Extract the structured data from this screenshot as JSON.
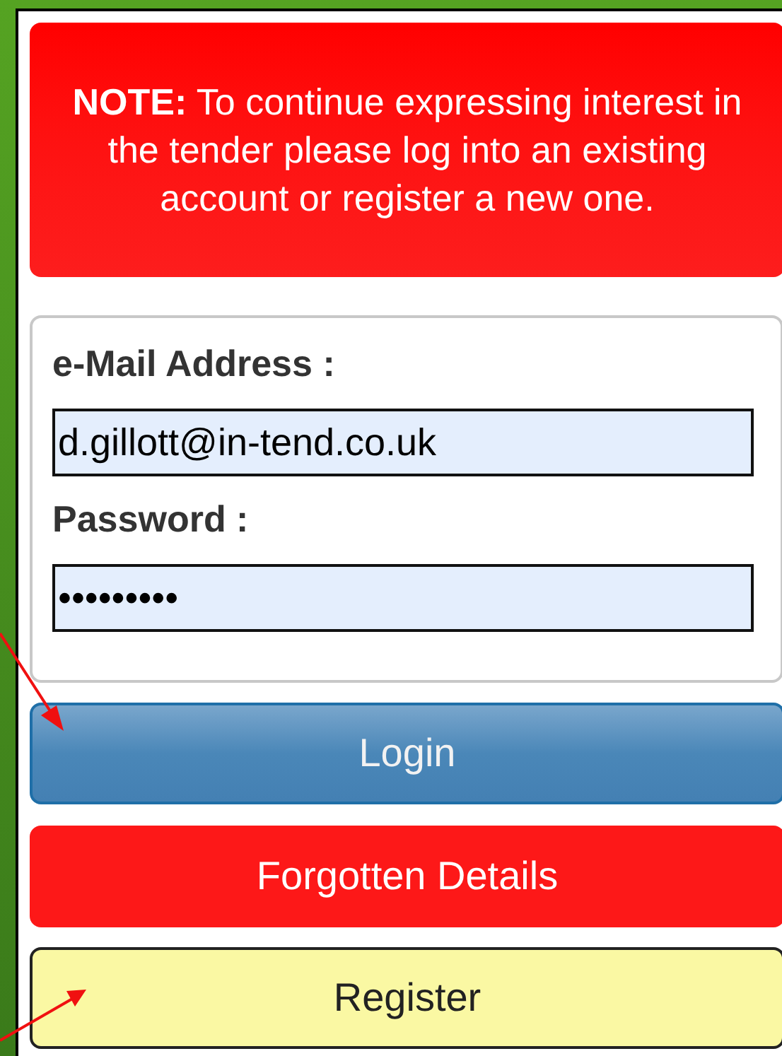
{
  "note": {
    "text": "**NOTE:** To continue expressing interest in the tender please log into an existing account or register a new one."
  },
  "form": {
    "fields": [
      {
        "label": "e-Mail Address :",
        "value": "d.gillott@in-tend.co.uk"
      },
      {
        "label": "Password :",
        "value": "•••••••••"
      }
    ]
  },
  "buttons": [
    {
      "kind": "primary",
      "label": "Login"
    },
    {
      "kind": "danger",
      "label": "Forgotten Details"
    },
    {
      "kind": "secondary",
      "label": "Register"
    }
  ]
}
